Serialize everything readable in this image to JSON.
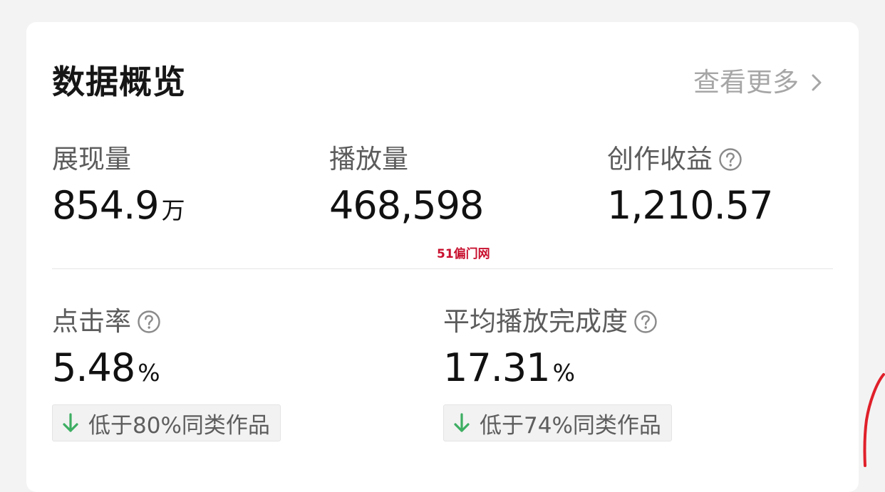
{
  "header": {
    "title": "数据概览",
    "more_label": "查看更多"
  },
  "stats_top": [
    {
      "label": "展现量",
      "value": "854.9",
      "unit": "万",
      "has_help": false
    },
    {
      "label": "播放量",
      "value": "468,598",
      "unit": "",
      "has_help": false
    },
    {
      "label": "创作收益",
      "value": "1,210.57",
      "unit": "",
      "has_help": true
    }
  ],
  "stats_bottom": [
    {
      "label": "点击率",
      "value": "5.48",
      "unit": "%",
      "compare": "低于80%同类作品"
    },
    {
      "label": "平均播放完成度",
      "value": "17.31",
      "unit": "%",
      "compare": "低于74%同类作品"
    }
  ],
  "watermark": "51偏门网",
  "colors": {
    "down_arrow": "#3dae62",
    "muted_text": "#a6a6a6",
    "watermark": "#c8102e",
    "scribble": "#e0202a"
  }
}
